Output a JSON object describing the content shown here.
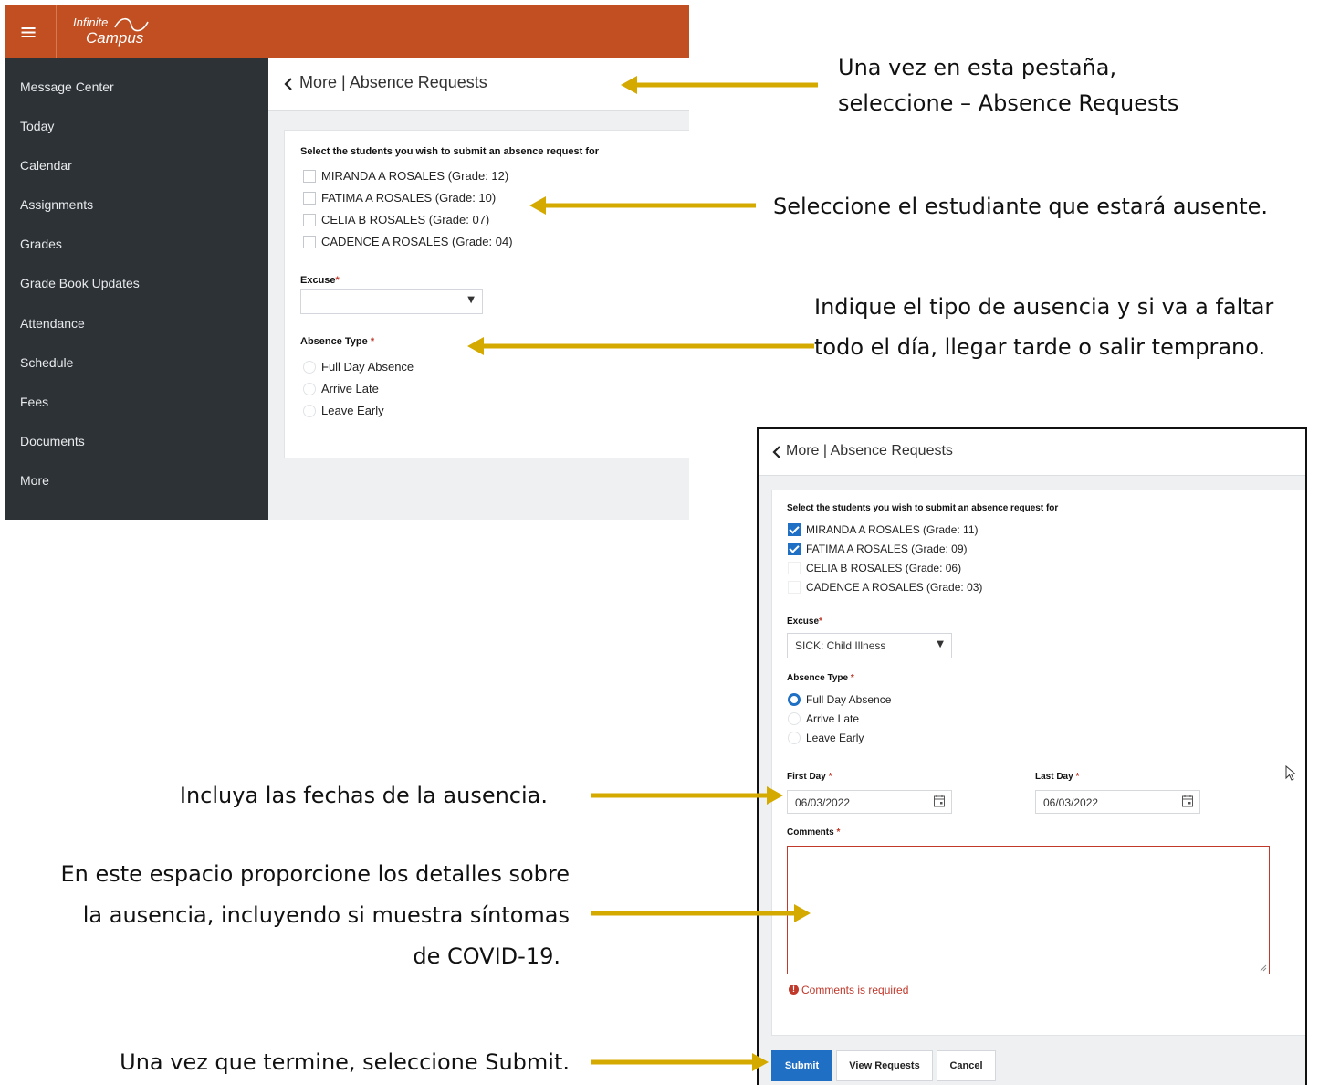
{
  "app": {
    "logo_line1": "Infinite",
    "logo_line2": "Campus"
  },
  "sidebar": {
    "items": [
      {
        "label": "Message Center"
      },
      {
        "label": "Today"
      },
      {
        "label": "Calendar"
      },
      {
        "label": "Assignments"
      },
      {
        "label": "Grades"
      },
      {
        "label": "Grade Book Updates"
      },
      {
        "label": "Attendance"
      },
      {
        "label": "Schedule"
      },
      {
        "label": "Fees"
      },
      {
        "label": "Documents"
      },
      {
        "label": "More"
      }
    ]
  },
  "form1": {
    "header": "More | Absence Requests",
    "select_students_label": "Select the students you wish to submit an absence request for",
    "students": [
      {
        "label": "MIRANDA A ROSALES (Grade: 12)",
        "checked": false
      },
      {
        "label": "FATIMA A ROSALES (Grade: 10)",
        "checked": false
      },
      {
        "label": "CELIA B ROSALES (Grade: 07)",
        "checked": false
      },
      {
        "label": "CADENCE A ROSALES (Grade: 04)",
        "checked": false
      }
    ],
    "excuse_label": "Excuse",
    "excuse_value": "",
    "absence_type_label": "Absence Type",
    "absence_types": [
      {
        "label": "Full Day Absence",
        "selected": false
      },
      {
        "label": "Arrive Late",
        "selected": false
      },
      {
        "label": "Leave Early",
        "selected": false
      }
    ]
  },
  "form2": {
    "header": "More | Absence Requests",
    "select_students_label": "Select the students you wish to submit an absence request for",
    "students": [
      {
        "label": "MIRANDA A ROSALES (Grade: 11)",
        "checked": true
      },
      {
        "label": "FATIMA A ROSALES (Grade: 09)",
        "checked": true
      },
      {
        "label": "CELIA B ROSALES (Grade: 06)",
        "checked": false
      },
      {
        "label": "CADENCE A ROSALES (Grade: 03)",
        "checked": false
      }
    ],
    "excuse_label": "Excuse",
    "excuse_value": "SICK: Child Illness",
    "absence_type_label": "Absence Type",
    "absence_types": [
      {
        "label": "Full Day Absence",
        "selected": true
      },
      {
        "label": "Arrive Late",
        "selected": false
      },
      {
        "label": "Leave Early",
        "selected": false
      }
    ],
    "first_day_label": "First Day",
    "first_day_value": "06/03/2022",
    "last_day_label": "Last Day",
    "last_day_value": "06/03/2022",
    "comments_label": "Comments",
    "comments_value": "",
    "comments_error": "Comments is required",
    "buttons": {
      "submit": "Submit",
      "view_requests": "View Requests",
      "cancel": "Cancel"
    }
  },
  "annotations": {
    "tab_note_line1": "Una vez en esta pestaña,",
    "tab_note_line2": "seleccione – Absence Requests",
    "student_note": "Seleccione el estudiante que estará ausente.",
    "type_note_line1": "Indique el tipo de ausencia y si va a faltar",
    "type_note_line2": "todo el día, llegar tarde o salir temprano.",
    "dates_note": "Incluya las fechas de la ausencia.",
    "details_note_line1": "En este espacio proporcione los detalles sobre",
    "details_note_line2": "la ausencia, incluyendo si muestra síntomas",
    "details_note_line3": "de COVID-19.",
    "submit_note": "Una vez que termine, seleccione Submit."
  },
  "colors": {
    "topbar": "#c24f22",
    "sidebar": "#2c3236",
    "accent": "#1f6fc5",
    "arrow": "#d4aa00",
    "error": "#c0392b"
  }
}
